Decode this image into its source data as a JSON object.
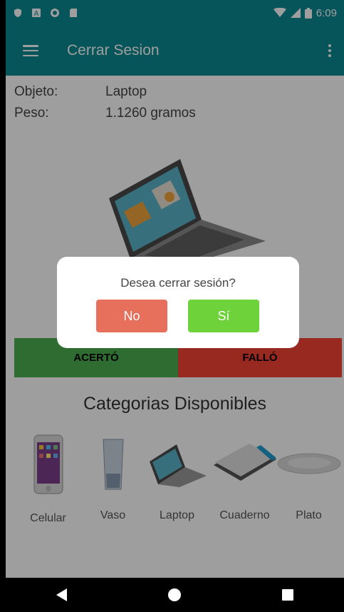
{
  "status_bar": {
    "time": "6:09",
    "left_icons": [
      "shield-icon",
      "a-icon",
      "circle-icon",
      "sdcard-icon"
    ],
    "right_icons": [
      "wifi-icon",
      "signal-icon",
      "battery-icon"
    ]
  },
  "toolbar": {
    "title": "Cerrar Sesion",
    "menu_icon": "hamburger-icon",
    "overflow_icon": "more-vert-icon"
  },
  "item": {
    "object_label": "Objeto:",
    "object_value": "Laptop",
    "weight_label": "Peso:",
    "weight_value": "1.1260 gramos"
  },
  "result_buttons": {
    "hit": "ACERTÓ",
    "miss": "FALLÓ"
  },
  "categories": {
    "heading": "Categorias Disponibles",
    "items": [
      {
        "label": "Celular"
      },
      {
        "label": "Vaso"
      },
      {
        "label": "Laptop"
      },
      {
        "label": "Cuaderno"
      },
      {
        "label": "Plato"
      }
    ]
  },
  "dialog": {
    "message": "Desea cerrar sesión?",
    "no": "No",
    "yes": "Sí"
  },
  "colors": {
    "primary": "#0a8a92",
    "hit": "#4caf50",
    "miss": "#f44336",
    "no_button": "#e6705c",
    "yes_button": "#6ed33a"
  }
}
